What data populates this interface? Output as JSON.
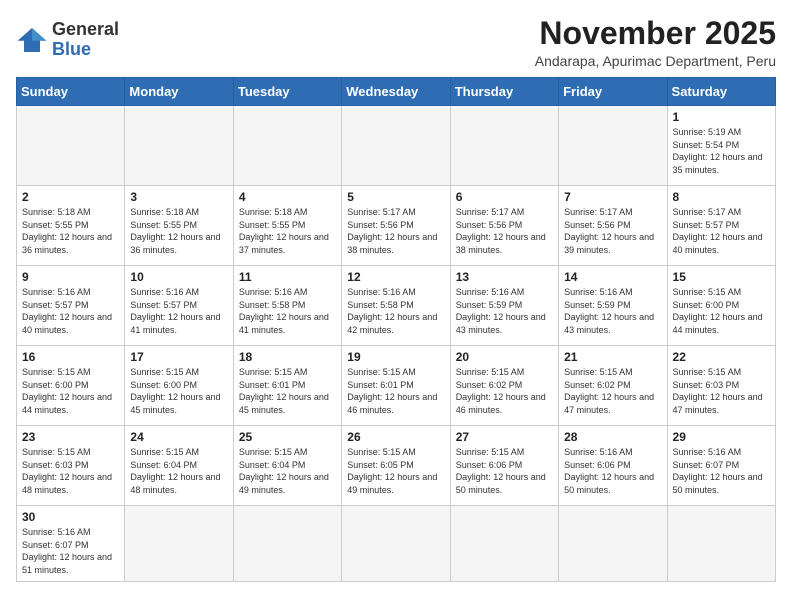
{
  "logo": {
    "general": "General",
    "blue": "Blue"
  },
  "title": "November 2025",
  "location": "Andarapa, Apurimac Department, Peru",
  "days_of_week": [
    "Sunday",
    "Monday",
    "Tuesday",
    "Wednesday",
    "Thursday",
    "Friday",
    "Saturday"
  ],
  "weeks": [
    [
      {
        "day": "",
        "empty": true
      },
      {
        "day": "",
        "empty": true
      },
      {
        "day": "",
        "empty": true
      },
      {
        "day": "",
        "empty": true
      },
      {
        "day": "",
        "empty": true
      },
      {
        "day": "",
        "empty": true
      },
      {
        "day": "1",
        "sunrise": "5:19 AM",
        "sunset": "5:54 PM",
        "daylight": "12 hours and 35 minutes."
      }
    ],
    [
      {
        "day": "2",
        "sunrise": "5:18 AM",
        "sunset": "5:55 PM",
        "daylight": "12 hours and 36 minutes."
      },
      {
        "day": "3",
        "sunrise": "5:18 AM",
        "sunset": "5:55 PM",
        "daylight": "12 hours and 36 minutes."
      },
      {
        "day": "4",
        "sunrise": "5:18 AM",
        "sunset": "5:55 PM",
        "daylight": "12 hours and 37 minutes."
      },
      {
        "day": "5",
        "sunrise": "5:17 AM",
        "sunset": "5:56 PM",
        "daylight": "12 hours and 38 minutes."
      },
      {
        "day": "6",
        "sunrise": "5:17 AM",
        "sunset": "5:56 PM",
        "daylight": "12 hours and 38 minutes."
      },
      {
        "day": "7",
        "sunrise": "5:17 AM",
        "sunset": "5:56 PM",
        "daylight": "12 hours and 39 minutes."
      },
      {
        "day": "8",
        "sunrise": "5:17 AM",
        "sunset": "5:57 PM",
        "daylight": "12 hours and 40 minutes."
      }
    ],
    [
      {
        "day": "9",
        "sunrise": "5:16 AM",
        "sunset": "5:57 PM",
        "daylight": "12 hours and 40 minutes."
      },
      {
        "day": "10",
        "sunrise": "5:16 AM",
        "sunset": "5:57 PM",
        "daylight": "12 hours and 41 minutes."
      },
      {
        "day": "11",
        "sunrise": "5:16 AM",
        "sunset": "5:58 PM",
        "daylight": "12 hours and 41 minutes."
      },
      {
        "day": "12",
        "sunrise": "5:16 AM",
        "sunset": "5:58 PM",
        "daylight": "12 hours and 42 minutes."
      },
      {
        "day": "13",
        "sunrise": "5:16 AM",
        "sunset": "5:59 PM",
        "daylight": "12 hours and 43 minutes."
      },
      {
        "day": "14",
        "sunrise": "5:16 AM",
        "sunset": "5:59 PM",
        "daylight": "12 hours and 43 minutes."
      },
      {
        "day": "15",
        "sunrise": "5:15 AM",
        "sunset": "6:00 PM",
        "daylight": "12 hours and 44 minutes."
      }
    ],
    [
      {
        "day": "16",
        "sunrise": "5:15 AM",
        "sunset": "6:00 PM",
        "daylight": "12 hours and 44 minutes."
      },
      {
        "day": "17",
        "sunrise": "5:15 AM",
        "sunset": "6:00 PM",
        "daylight": "12 hours and 45 minutes."
      },
      {
        "day": "18",
        "sunrise": "5:15 AM",
        "sunset": "6:01 PM",
        "daylight": "12 hours and 45 minutes."
      },
      {
        "day": "19",
        "sunrise": "5:15 AM",
        "sunset": "6:01 PM",
        "daylight": "12 hours and 46 minutes."
      },
      {
        "day": "20",
        "sunrise": "5:15 AM",
        "sunset": "6:02 PM",
        "daylight": "12 hours and 46 minutes."
      },
      {
        "day": "21",
        "sunrise": "5:15 AM",
        "sunset": "6:02 PM",
        "daylight": "12 hours and 47 minutes."
      },
      {
        "day": "22",
        "sunrise": "5:15 AM",
        "sunset": "6:03 PM",
        "daylight": "12 hours and 47 minutes."
      }
    ],
    [
      {
        "day": "23",
        "sunrise": "5:15 AM",
        "sunset": "6:03 PM",
        "daylight": "12 hours and 48 minutes."
      },
      {
        "day": "24",
        "sunrise": "5:15 AM",
        "sunset": "6:04 PM",
        "daylight": "12 hours and 48 minutes."
      },
      {
        "day": "25",
        "sunrise": "5:15 AM",
        "sunset": "6:04 PM",
        "daylight": "12 hours and 49 minutes."
      },
      {
        "day": "26",
        "sunrise": "5:15 AM",
        "sunset": "6:05 PM",
        "daylight": "12 hours and 49 minutes."
      },
      {
        "day": "27",
        "sunrise": "5:15 AM",
        "sunset": "6:06 PM",
        "daylight": "12 hours and 50 minutes."
      },
      {
        "day": "28",
        "sunrise": "5:16 AM",
        "sunset": "6:06 PM",
        "daylight": "12 hours and 50 minutes."
      },
      {
        "day": "29",
        "sunrise": "5:16 AM",
        "sunset": "6:07 PM",
        "daylight": "12 hours and 50 minutes."
      }
    ],
    [
      {
        "day": "30",
        "sunrise": "5:16 AM",
        "sunset": "6:07 PM",
        "daylight": "12 hours and 51 minutes."
      },
      {
        "day": "",
        "empty": true
      },
      {
        "day": "",
        "empty": true
      },
      {
        "day": "",
        "empty": true
      },
      {
        "day": "",
        "empty": true
      },
      {
        "day": "",
        "empty": true
      },
      {
        "day": "",
        "empty": true
      }
    ]
  ],
  "labels": {
    "sunrise": "Sunrise:",
    "sunset": "Sunset:",
    "daylight": "Daylight:"
  }
}
